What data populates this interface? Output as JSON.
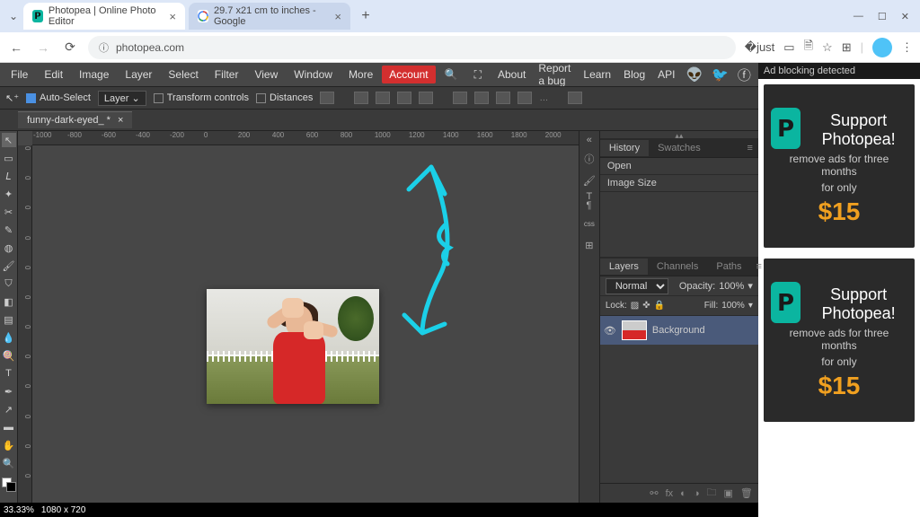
{
  "browser": {
    "tabs": [
      {
        "title": "Photopea | Online Photo Editor"
      },
      {
        "title": "29.7 x21 cm to inches - Google "
      }
    ],
    "url": "photopea.com"
  },
  "menu": [
    "File",
    "Edit",
    "Image",
    "Layer",
    "Select",
    "Filter",
    "View",
    "Window",
    "More"
  ],
  "account": "Account",
  "topright": [
    "About",
    "Report a bug",
    "Learn",
    "Blog",
    "API"
  ],
  "options": {
    "autoselect": "Auto-Select",
    "layer": "Layer",
    "transform": "Transform controls",
    "distances": "Distances"
  },
  "doc": {
    "name": "funny-dark-eyed_ *"
  },
  "ruler_h": [
    "-1000",
    "-800",
    "-600",
    "-400",
    "-200",
    "0",
    "200",
    "400",
    "600",
    "800",
    "1000",
    "1200",
    "1400",
    "1600",
    "1800",
    "2000"
  ],
  "ruler_v": [
    "0",
    "0",
    "0",
    "0",
    "0",
    "0",
    "0",
    "0",
    "0",
    "0",
    "0",
    "0"
  ],
  "status": {
    "zoom": "33.33%",
    "dims": "1080 x 720"
  },
  "history": {
    "tab1": "History",
    "tab2": "Swatches",
    "items": [
      "Open",
      "Image Size"
    ]
  },
  "layers": {
    "tab1": "Layers",
    "tab2": "Channels",
    "tab3": "Paths",
    "blend": "Normal",
    "opacity_label": "Opacity:",
    "opacity": "100%",
    "lock": "Lock:",
    "fill_label": "Fill:",
    "fill": "100%",
    "layer0": "Background"
  },
  "ads": {
    "head": "Ad blocking detected",
    "title": "Support Photopea!",
    "line1": "remove ads for three months",
    "line2": "for only",
    "price": "$15"
  }
}
